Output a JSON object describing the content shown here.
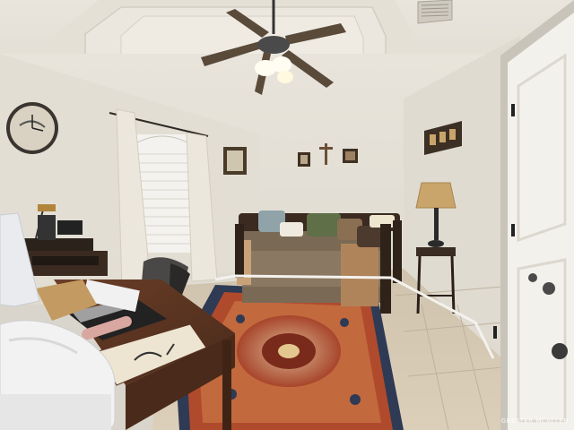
{
  "scene": {
    "type": "photo",
    "subject": "bedroom-office"
  },
  "watermark": {
    "text": "GREATER MCALLEN"
  },
  "colors": {
    "wall": "#e6e2d8",
    "ceiling": "#ece8de",
    "floor_tile": "#d8ccb8",
    "rug_red": "#a8452c",
    "rug_navy": "#2f3a55",
    "desk_wood": "#5a3422",
    "door": "#f3f1ec",
    "couch_fabric": "#7a6a55"
  }
}
